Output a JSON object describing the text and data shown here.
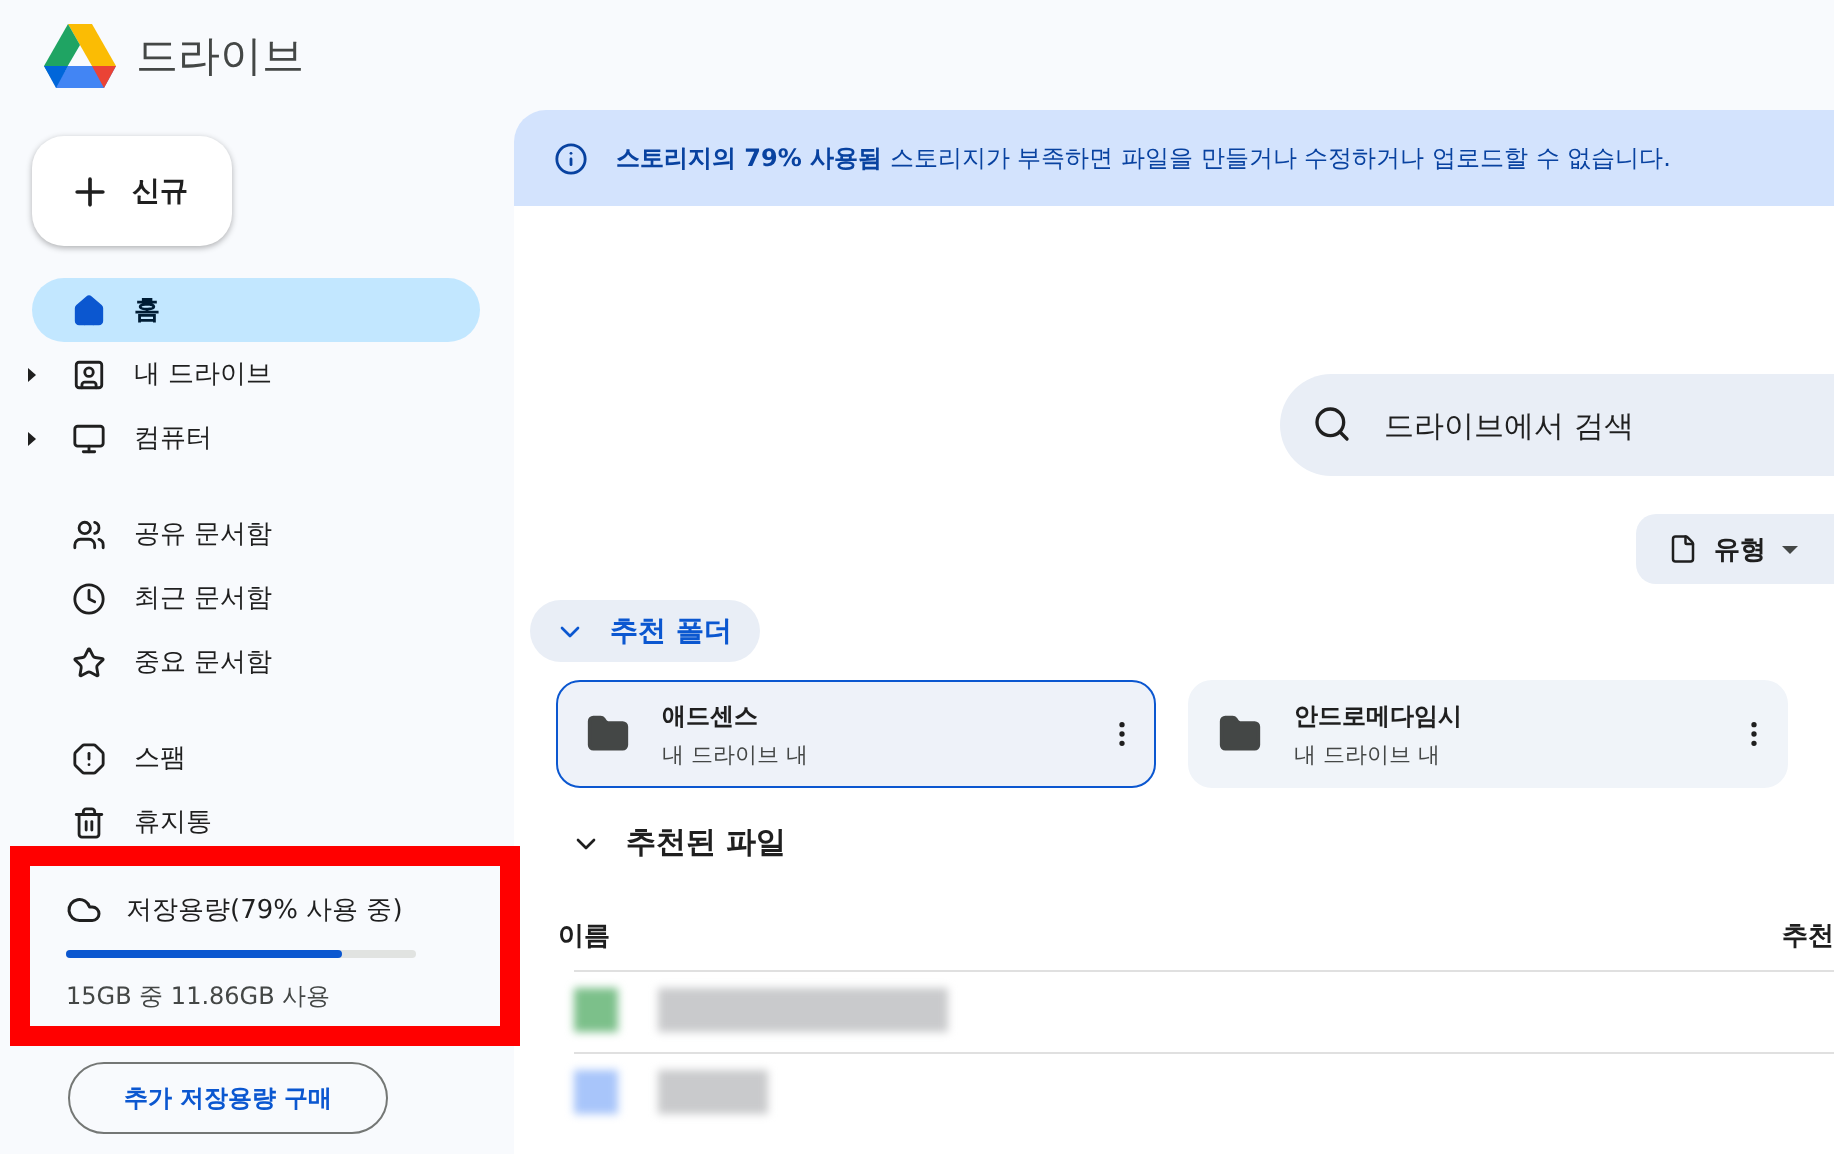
{
  "app": {
    "title": "드라이브"
  },
  "new_button": "신규",
  "nav_groups": [
    [
      {
        "label": "홈",
        "kind": "home",
        "selected": true,
        "expandable": false
      },
      {
        "label": "내 드라이브",
        "kind": "drive",
        "selected": false,
        "expandable": true
      },
      {
        "label": "컴퓨터",
        "kind": "computer",
        "selected": false,
        "expandable": true
      }
    ],
    [
      {
        "label": "공유 문서함",
        "kind": "shared",
        "selected": false,
        "expandable": false
      },
      {
        "label": "최근 문서함",
        "kind": "recent",
        "selected": false,
        "expandable": false
      },
      {
        "label": "중요 문서함",
        "kind": "starred",
        "selected": false,
        "expandable": false
      }
    ],
    [
      {
        "label": "스팸",
        "kind": "spam",
        "selected": false,
        "expandable": false
      },
      {
        "label": "휴지통",
        "kind": "trash",
        "selected": false,
        "expandable": false
      }
    ]
  ],
  "storage": {
    "title": "저장용량(79% 사용 중)",
    "level": 0.79,
    "usage": "15GB 중 11.86GB 사용",
    "highlighted": true
  },
  "buy_button": "추가 저장용량 구매",
  "banner": {
    "text": "**스토리지의 79% 사용됨** 스토리지가 부족하면 파일을 만들거나 수정하거나 업로드할 수 없습니다."
  },
  "search": {
    "placeholder": "드라이브에서 검색"
  },
  "filter_chip": "유형",
  "suggested_folders": {
    "label": "추천 폴더",
    "expanded": true,
    "folders": [
      {
        "name": "애드센스",
        "location": "내 드라이브 내",
        "selected": true
      },
      {
        "name": "안드로메다임시",
        "location": "내 드라이브 내",
        "selected": false
      }
    ]
  },
  "suggested_files": {
    "label": "추천된 파일",
    "expanded": true,
    "columns": [
      "이름",
      "추천"
    ],
    "rows": [
      {
        "kind": "sheet"
      },
      {
        "kind": "doc"
      }
    ]
  }
}
